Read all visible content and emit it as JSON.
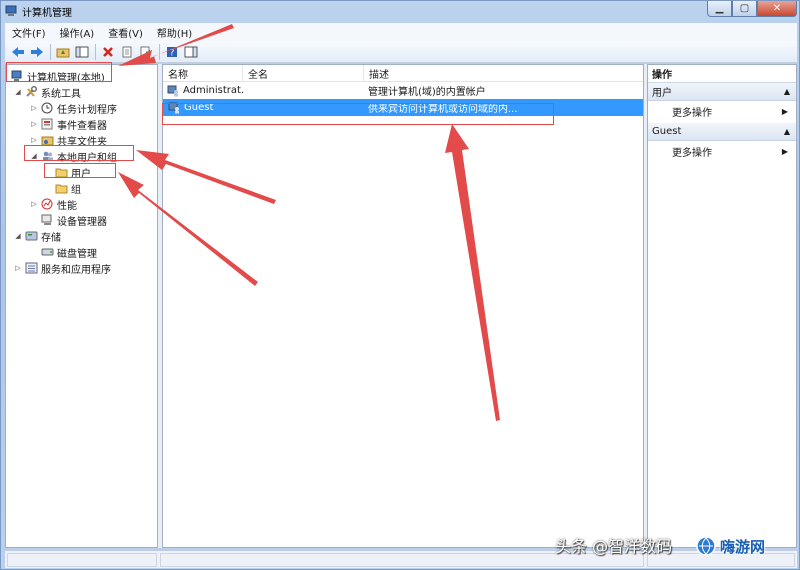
{
  "window": {
    "title": "计算机管理",
    "min_label": "▁",
    "max_label": "▢",
    "close_label": "✕"
  },
  "menu": [
    "文件(F)",
    "操作(A)",
    "查看(V)",
    "帮助(H)"
  ],
  "tree": {
    "root": "计算机管理(本地)",
    "system_tools": "系统工具",
    "task_scheduler": "任务计划程序",
    "event_viewer": "事件查看器",
    "shared_folders": "共享文件夹",
    "local_users_groups": "本地用户和组",
    "users": "用户",
    "groups": "组",
    "performance": "性能",
    "device_manager": "设备管理器",
    "storage": "存储",
    "disk_management": "磁盘管理",
    "services_apps": "服务和应用程序"
  },
  "list": {
    "columns": [
      "名称",
      "全名",
      "描述"
    ],
    "rows": [
      {
        "name": "Administrat...",
        "full_name": "",
        "desc": "管理计算机(域)的内置帐户"
      },
      {
        "name": "Guest",
        "full_name": "",
        "desc": "供来宾访问计算机或访问域的内..."
      }
    ]
  },
  "actions": {
    "title": "操作",
    "group1": "用户",
    "group1_more": "更多操作",
    "group2": "Guest",
    "group2_more": "更多操作"
  },
  "watermark": {
    "text": "头条 @智洋数码",
    "logo": "嗨游网"
  },
  "colors": {
    "selection": "#3399ff",
    "annotation": "#e34a4a"
  }
}
